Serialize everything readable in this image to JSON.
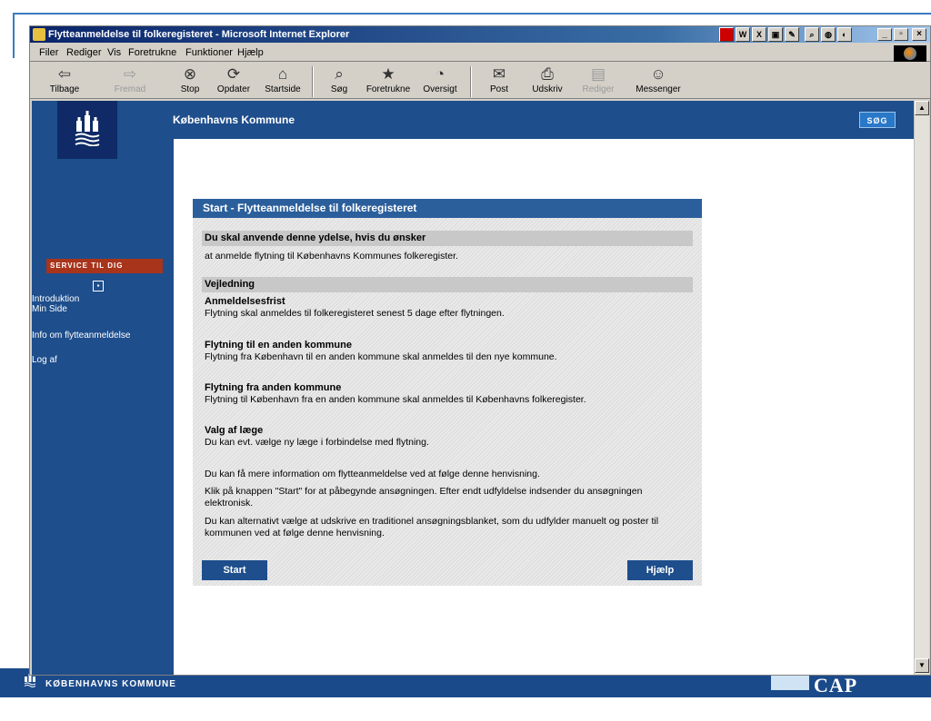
{
  "window": {
    "title": "Flytteanmeldelse til folkeregisteret - Microsoft Internet Explorer"
  },
  "menu": [
    "Filer",
    "Rediger",
    "Vis",
    "Foretrukne",
    "Funktioner",
    "Hjælp"
  ],
  "toolbar": {
    "back": "Tilbage",
    "forward": "Fremad",
    "stop": "Stop",
    "refresh": "Opdater",
    "home": "Startside",
    "search": "Søg",
    "favorites": "Foretrukne",
    "history": "Oversigt",
    "mail": "Post",
    "print": "Udskriv",
    "edit": "Rediger",
    "messenger": "Messenger"
  },
  "header": {
    "site_title": "Københavns Kommune",
    "search_button": "SØG"
  },
  "nav": {
    "service_badge": "SERVICE TIL DIG",
    "collapse_glyph": "▪",
    "items": [
      "Introduktion",
      "Min Side",
      "Info om flytteanmeldelse",
      "Log af"
    ]
  },
  "panel": {
    "title": "Start - Flytteanmeldelse til folkeregisteret",
    "use_head": "Du skal anvende denne ydelse, hvis du ønsker",
    "use_text": "at anmelde flytning til Københavns Kommunes folkeregister.",
    "guide_head": "Vejledning",
    "blocks": [
      {
        "title": "Anmeldelsesfrist",
        "text": "Flytning skal anmeldes til folkeregisteret senest 5 dage efter flytningen."
      },
      {
        "title": "Flytning til en anden kommune",
        "text": "Flytning fra København til en anden kommune skal anmeldes til den nye kommune."
      },
      {
        "title": "Flytning fra anden kommune",
        "text": "Flytning til København fra en anden kommune skal anmeldes til Københavns folkeregister."
      },
      {
        "title": "Valg af læge",
        "text": "Du kan evt. vælge ny læge i forbindelse med flytning."
      }
    ],
    "info_1": "Du kan få mere information om flytteanmeldelse ved at følge denne henvisning.",
    "info_2": "Klik på knappen \"Start\" for at påbegynde ansøgningen. Efter endt udfyldelse indsender du ansøgningen elektronisk.",
    "info_3": "Du kan alternativt vælge at udskrive en traditionel ansøgningsblanket, som du udfylder manuelt og poster til kommunen ved at følge denne henvisning.",
    "start_button": "Start",
    "help_button": "Hjælp"
  },
  "footer": {
    "left_text": "KØBENHAVNS KOMMUNE",
    "right_text": "CAP GEMINI"
  },
  "colors": {
    "brand_blue": "#1e4e8c",
    "panel_title_blue": "#2b5f9c",
    "service_red": "#a8341b"
  },
  "icons": {
    "logo": "copenhagen-coat-of-arms-icon"
  }
}
